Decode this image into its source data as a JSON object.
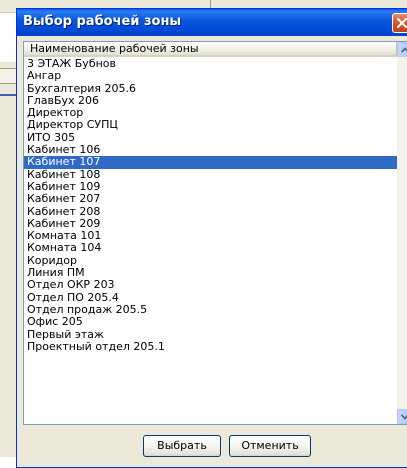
{
  "dialog": {
    "title": "Выбор рабочей зоны",
    "list": {
      "column_header": "Наименование рабочей зоны",
      "selected_index": 8,
      "items": [
        "3 ЭТАЖ Бубнов",
        "Ангар",
        "Бухгалтерия 205.6",
        "ГлавБух 206",
        "Директор",
        "Директор СУПЦ",
        "ИТО 305",
        "Кабинет 106",
        "Кабинет 107",
        "Кабинет 108",
        "Кабинет 109",
        "Кабинет 207",
        "Кабинет 208",
        "Кабинет 209",
        "Комната 101",
        "Комната 104",
        "Коридор",
        "Линия ПМ",
        "Отдел ОКР 203",
        "Отдел ПО 205.4",
        "Отдел продаж 205.5",
        "Офис 205",
        "Первый этаж",
        "Проектный отдел 205.1"
      ]
    },
    "buttons": {
      "select_label": "Выбрать",
      "cancel_label": "Отменить"
    }
  },
  "colors": {
    "titlebar": "#0049d6",
    "selection": "#316ac5",
    "close": "#d8542b"
  },
  "icons": {
    "close": "close-icon",
    "scroll_up": "arrow-up-icon",
    "scroll_down": "arrow-down-icon"
  }
}
